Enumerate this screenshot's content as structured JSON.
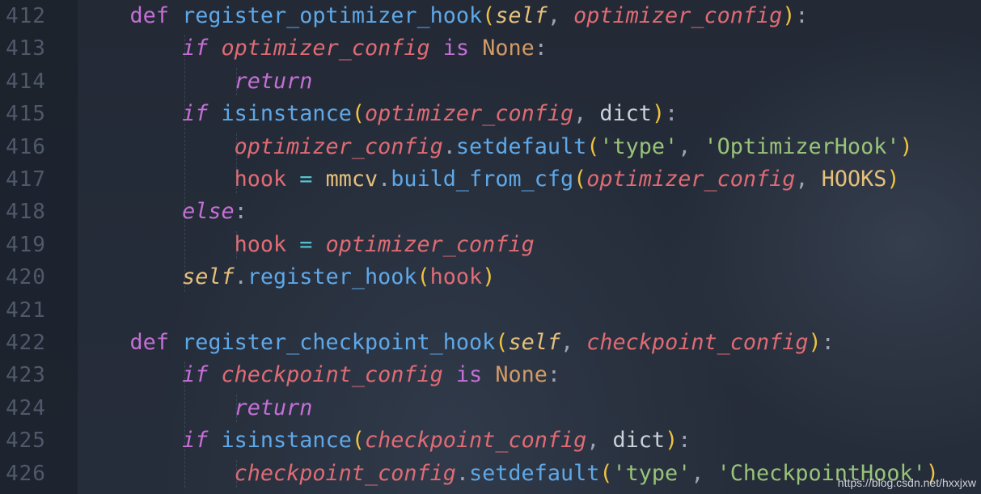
{
  "editor": {
    "lines": [
      {
        "num": "412",
        "tokens": [
          {
            "t": "    ",
            "c": "plain"
          },
          {
            "t": "def",
            "c": "k-def"
          },
          {
            "t": " ",
            "c": "plain"
          },
          {
            "t": "register_optimizer_hook",
            "c": "fn"
          },
          {
            "t": "(",
            "c": "paren"
          },
          {
            "t": "self",
            "c": "self"
          },
          {
            "t": ", ",
            "c": "punct"
          },
          {
            "t": "optimizer_config",
            "c": "param"
          },
          {
            "t": ")",
            "c": "paren"
          },
          {
            "t": ":",
            "c": "punct"
          }
        ]
      },
      {
        "num": "413",
        "tokens": [
          {
            "t": "        ",
            "c": "plain"
          },
          {
            "t": "if",
            "c": "k-ctl"
          },
          {
            "t": " ",
            "c": "plain"
          },
          {
            "t": "optimizer_config",
            "c": "param"
          },
          {
            "t": " ",
            "c": "plain"
          },
          {
            "t": "is",
            "c": "k-def"
          },
          {
            "t": " ",
            "c": "plain"
          },
          {
            "t": "None",
            "c": "const"
          },
          {
            "t": ":",
            "c": "punct"
          }
        ]
      },
      {
        "num": "414",
        "tokens": [
          {
            "t": "            ",
            "c": "plain"
          },
          {
            "t": "return",
            "c": "k-ctl"
          }
        ]
      },
      {
        "num": "415",
        "tokens": [
          {
            "t": "        ",
            "c": "plain"
          },
          {
            "t": "if",
            "c": "k-ctl"
          },
          {
            "t": " ",
            "c": "plain"
          },
          {
            "t": "isinstance",
            "c": "bi"
          },
          {
            "t": "(",
            "c": "paren"
          },
          {
            "t": "optimizer_config",
            "c": "param"
          },
          {
            "t": ", ",
            "c": "punct"
          },
          {
            "t": "dict",
            "c": "plain"
          },
          {
            "t": ")",
            "c": "paren"
          },
          {
            "t": ":",
            "c": "punct"
          }
        ]
      },
      {
        "num": "416",
        "tokens": [
          {
            "t": "            ",
            "c": "plain"
          },
          {
            "t": "optimizer_config",
            "c": "param"
          },
          {
            "t": ".",
            "c": "punct"
          },
          {
            "t": "setdefault",
            "c": "fn"
          },
          {
            "t": "(",
            "c": "paren"
          },
          {
            "t": "'type'",
            "c": "str"
          },
          {
            "t": ", ",
            "c": "punct"
          },
          {
            "t": "'OptimizerHook'",
            "c": "str"
          },
          {
            "t": ")",
            "c": "paren"
          }
        ]
      },
      {
        "num": "417",
        "tokens": [
          {
            "t": "            ",
            "c": "plain"
          },
          {
            "t": "hook",
            "c": "var"
          },
          {
            "t": " ",
            "c": "plain"
          },
          {
            "t": "=",
            "c": "op"
          },
          {
            "t": " ",
            "c": "plain"
          },
          {
            "t": "mmcv",
            "c": "cls"
          },
          {
            "t": ".",
            "c": "punct"
          },
          {
            "t": "build_from_cfg",
            "c": "fn"
          },
          {
            "t": "(",
            "c": "paren"
          },
          {
            "t": "optimizer_config",
            "c": "param"
          },
          {
            "t": ", ",
            "c": "punct"
          },
          {
            "t": "HOOKS",
            "c": "cls"
          },
          {
            "t": ")",
            "c": "paren"
          }
        ]
      },
      {
        "num": "418",
        "tokens": [
          {
            "t": "        ",
            "c": "plain"
          },
          {
            "t": "else",
            "c": "k-ctl"
          },
          {
            "t": ":",
            "c": "punct"
          }
        ]
      },
      {
        "num": "419",
        "tokens": [
          {
            "t": "            ",
            "c": "plain"
          },
          {
            "t": "hook",
            "c": "var"
          },
          {
            "t": " ",
            "c": "plain"
          },
          {
            "t": "=",
            "c": "op"
          },
          {
            "t": " ",
            "c": "plain"
          },
          {
            "t": "optimizer_config",
            "c": "param"
          }
        ]
      },
      {
        "num": "420",
        "tokens": [
          {
            "t": "        ",
            "c": "plain"
          },
          {
            "t": "self",
            "c": "self"
          },
          {
            "t": ".",
            "c": "punct"
          },
          {
            "t": "register_hook",
            "c": "fn"
          },
          {
            "t": "(",
            "c": "paren"
          },
          {
            "t": "hook",
            "c": "var"
          },
          {
            "t": ")",
            "c": "paren"
          }
        ]
      },
      {
        "num": "421",
        "tokens": []
      },
      {
        "num": "422",
        "tokens": [
          {
            "t": "    ",
            "c": "plain"
          },
          {
            "t": "def",
            "c": "k-def"
          },
          {
            "t": " ",
            "c": "plain"
          },
          {
            "t": "register_checkpoint_hook",
            "c": "fn"
          },
          {
            "t": "(",
            "c": "paren"
          },
          {
            "t": "self",
            "c": "self"
          },
          {
            "t": ", ",
            "c": "punct"
          },
          {
            "t": "checkpoint_config",
            "c": "param"
          },
          {
            "t": ")",
            "c": "paren"
          },
          {
            "t": ":",
            "c": "punct"
          }
        ]
      },
      {
        "num": "423",
        "tokens": [
          {
            "t": "        ",
            "c": "plain"
          },
          {
            "t": "if",
            "c": "k-ctl"
          },
          {
            "t": " ",
            "c": "plain"
          },
          {
            "t": "checkpoint_config",
            "c": "param"
          },
          {
            "t": " ",
            "c": "plain"
          },
          {
            "t": "is",
            "c": "k-def"
          },
          {
            "t": " ",
            "c": "plain"
          },
          {
            "t": "None",
            "c": "const"
          },
          {
            "t": ":",
            "c": "punct"
          }
        ]
      },
      {
        "num": "424",
        "tokens": [
          {
            "t": "            ",
            "c": "plain"
          },
          {
            "t": "return",
            "c": "k-ctl"
          }
        ]
      },
      {
        "num": "425",
        "tokens": [
          {
            "t": "        ",
            "c": "plain"
          },
          {
            "t": "if",
            "c": "k-ctl"
          },
          {
            "t": " ",
            "c": "plain"
          },
          {
            "t": "isinstance",
            "c": "bi"
          },
          {
            "t": "(",
            "c": "paren"
          },
          {
            "t": "checkpoint_config",
            "c": "param"
          },
          {
            "t": ", ",
            "c": "punct"
          },
          {
            "t": "dict",
            "c": "plain"
          },
          {
            "t": ")",
            "c": "paren"
          },
          {
            "t": ":",
            "c": "punct"
          }
        ]
      },
      {
        "num": "426",
        "tokens": [
          {
            "t": "            ",
            "c": "plain"
          },
          {
            "t": "checkpoint_config",
            "c": "param"
          },
          {
            "t": ".",
            "c": "punct"
          },
          {
            "t": "setdefault",
            "c": "fn"
          },
          {
            "t": "(",
            "c": "paren"
          },
          {
            "t": "'type'",
            "c": "str"
          },
          {
            "t": ", ",
            "c": "punct"
          },
          {
            "t": "'CheckpointHook'",
            "c": "str"
          },
          {
            "t": ")",
            "c": "paren"
          }
        ]
      }
    ]
  },
  "watermark": "https://blog.csdn.net/hxxjxw"
}
